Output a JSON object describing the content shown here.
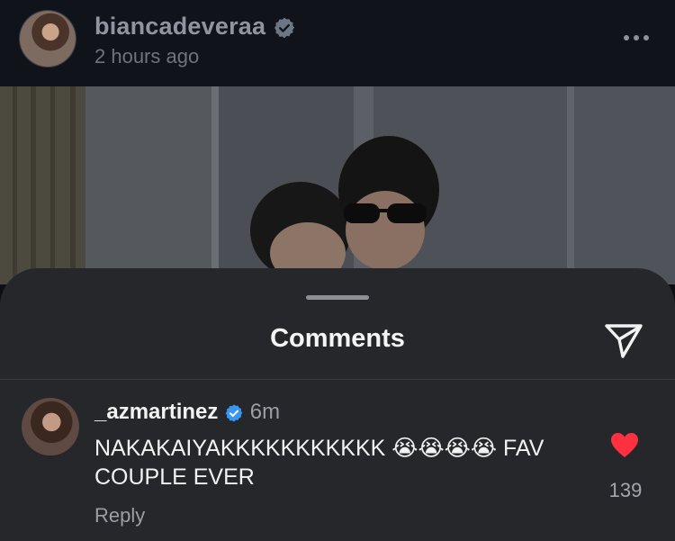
{
  "post": {
    "username": "biancadeveraa",
    "verified": true,
    "time": "2 hours ago",
    "more_icon": "more-horizontal-icon"
  },
  "comments_sheet": {
    "title": "Comments",
    "share_icon": "send-icon"
  },
  "comments": [
    {
      "username": "_azmartinez",
      "verified": true,
      "time": "6m",
      "text": "NAKAKAIYAKKKKKKKKKKK 😭😭😭😭 FAV COUPLE EVER",
      "like_count": "139",
      "liked": true,
      "reply_label": "Reply"
    }
  ],
  "colors": {
    "background": "#0d0f14",
    "sheet": "#25272b",
    "verified_blue": "#3897f0",
    "like_red": "#ff3040"
  }
}
